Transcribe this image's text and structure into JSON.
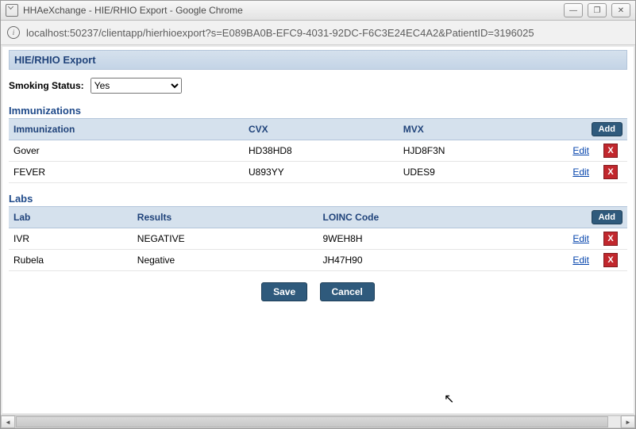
{
  "window": {
    "title": "HHAeXchange - HIE/RHIO Export - Google Chrome"
  },
  "address": "localhost:50237/clientapp/hierhioexport?s=E089BA0B-EFC9-4031-92DC-F6C3E24EC4A2&PatientID=3196025",
  "header": {
    "title": "HIE/RHIO Export"
  },
  "form": {
    "smoking_label": "Smoking Status:",
    "smoking_value": "Yes"
  },
  "immunizations": {
    "title": "Immunizations",
    "cols": {
      "c1": "Immunization",
      "c2": "CVX",
      "c3": "MVX"
    },
    "add_label": "Add",
    "rows": [
      {
        "name": "Gover",
        "cvx": "HD38HD8",
        "mvx": "HJD8F3N",
        "edit": "Edit"
      },
      {
        "name": "FEVER",
        "cvx": "U893YY",
        "mvx": "UDES9",
        "edit": "Edit"
      }
    ]
  },
  "labs": {
    "title": "Labs",
    "cols": {
      "c1": "Lab",
      "c2": "Results",
      "c3": "LOINC Code"
    },
    "add_label": "Add",
    "rows": [
      {
        "name": "IVR",
        "result": "NEGATIVE",
        "loinc": "9WEH8H",
        "edit": "Edit"
      },
      {
        "name": "Rubela",
        "result": "Negative",
        "loinc": "JH47H90",
        "edit": "Edit"
      }
    ]
  },
  "buttons": {
    "save": "Save",
    "cancel": "Cancel"
  },
  "glyphs": {
    "del": "X",
    "min": "—",
    "max": "❐",
    "close": "✕",
    "left": "◄",
    "right": "►",
    "info": "i"
  }
}
